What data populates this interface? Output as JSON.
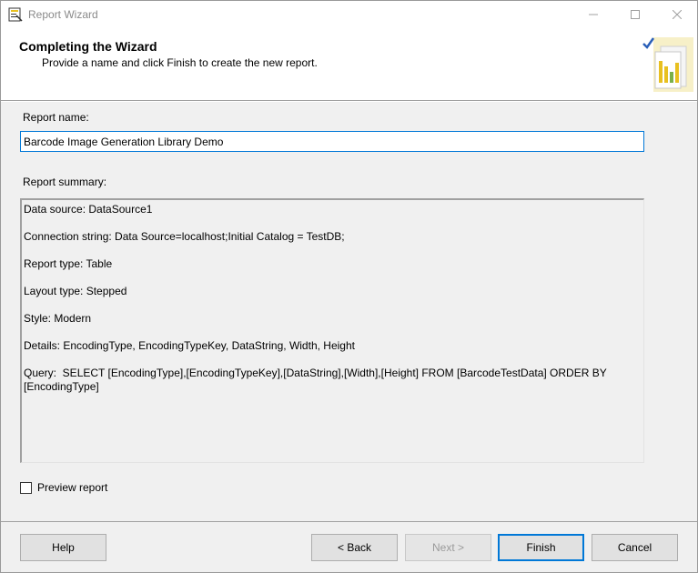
{
  "window": {
    "title": "Report Wizard"
  },
  "header": {
    "title": "Completing the Wizard",
    "subtitle": "Provide a name and click Finish to create the new report."
  },
  "form": {
    "report_name_label": "Report name:",
    "report_name_value": "Barcode Image Generation Library Demo",
    "report_summary_label": "Report summary:",
    "summary_lines": [
      "Data source: DataSource1",
      "Connection string: Data Source=localhost;Initial Catalog = TestDB;",
      "Report type: Table",
      "Layout type: Stepped",
      "Style: Modern",
      "Details: EncodingType, EncodingTypeKey, DataString, Width, Height",
      "Query:  SELECT [EncodingType],[EncodingTypeKey],[DataString],[Width],[Height] FROM [BarcodeTestData] ORDER BY [EncodingType]"
    ],
    "preview_label": "Preview report",
    "preview_checked": false
  },
  "buttons": {
    "help": "Help",
    "back": "< Back",
    "next": "Next >",
    "finish": "Finish",
    "cancel": "Cancel"
  },
  "colors": {
    "focus_border": "#0078d7",
    "content_bg": "#f0f0f0"
  },
  "icons": {
    "app": "report-wizard-icon",
    "header": "report-pages-check-icon",
    "minimize": "minimize-icon",
    "maximize": "maximize-icon",
    "close": "close-icon"
  }
}
